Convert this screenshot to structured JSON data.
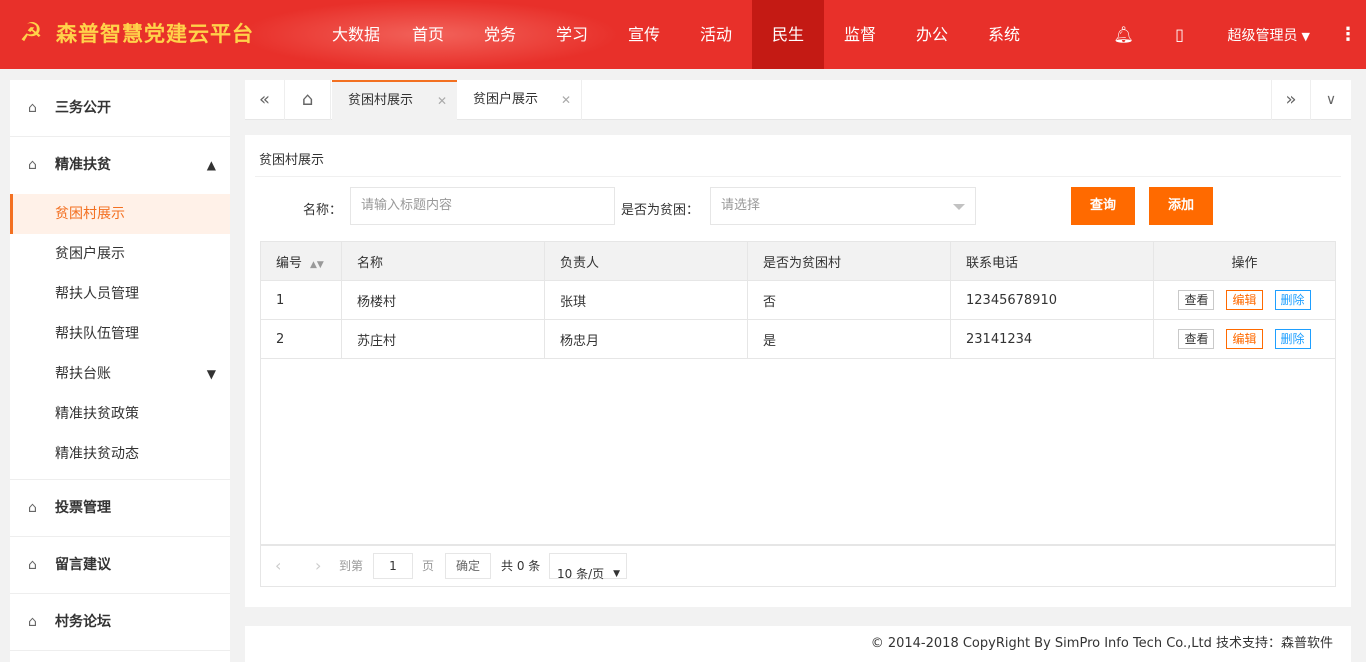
{
  "app": {
    "title": "森普智慧党建云平台"
  },
  "nav": [
    "大数据",
    "首页",
    "党务",
    "学习",
    "宣传",
    "活动",
    "民生",
    "监督",
    "办公",
    "系统"
  ],
  "header": {
    "user": "超级管理员"
  },
  "sidebar": {
    "groups": [
      "三务公开",
      "精准扶贫",
      "投票管理",
      "留言建议",
      "村务论坛"
    ],
    "subs": [
      "贫困村展示",
      "贫困户展示",
      "帮扶人员管理",
      "帮扶队伍管理",
      "帮扶台账",
      "精准扶贫政策",
      "精准扶贫动态"
    ]
  },
  "tabs": [
    "贫困村展示",
    "贫困户展示"
  ],
  "panel": {
    "title": "贫困村展示",
    "name_label": "名称：",
    "name_placeholder": "请输入标题内容",
    "poor_label": "是否为贫困：",
    "poor_placeholder": "请选择",
    "query": "查询",
    "add": "添加"
  },
  "table": {
    "headers": [
      "编号",
      "名称",
      "负责人",
      "是否为贫困村",
      "联系电话",
      "操作"
    ],
    "rows": [
      [
        "1",
        "杨楼村",
        "张琪",
        "否",
        "12345678910"
      ],
      [
        "2",
        "苏庄村",
        "杨忠月",
        "是",
        "23141234"
      ]
    ],
    "ops": [
      "查看",
      "编辑",
      "删除"
    ]
  },
  "pager": {
    "goto": "到第",
    "page_value": "1",
    "page": "页",
    "confirm": "确定",
    "total": "共 0 条",
    "size": "10 条/页"
  },
  "footer": "© 2014-2018 CopyRight By SimPro Info Tech Co.,Ltd 技术支持：森普软件"
}
